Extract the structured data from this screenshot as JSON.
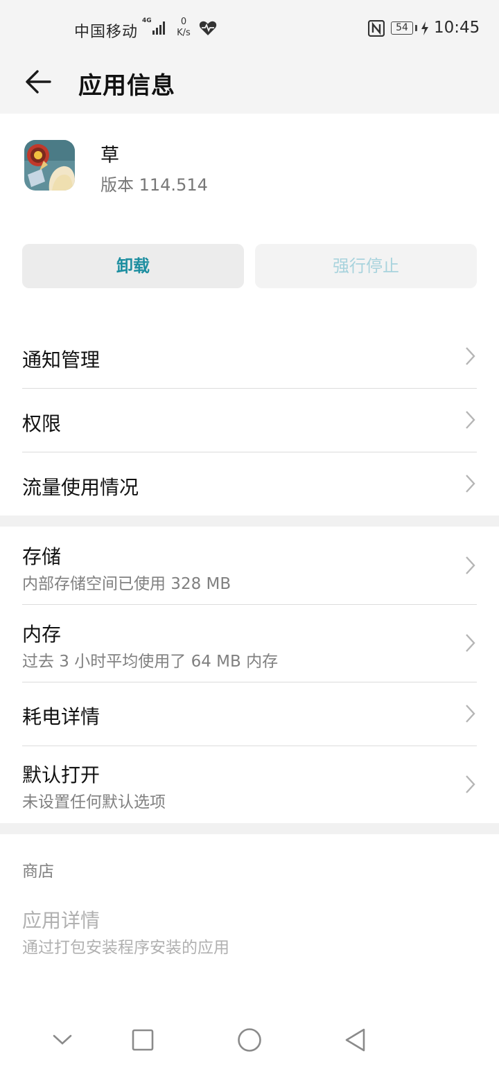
{
  "status_bar": {
    "carrier": "中国移动",
    "network_type": "4G",
    "speed_value": "0",
    "speed_unit": "K/s",
    "battery": "54",
    "time": "10:45"
  },
  "header": {
    "title": "应用信息"
  },
  "app": {
    "name": "草",
    "version": "版本 114.514"
  },
  "actions": {
    "uninstall": "卸载",
    "force_stop": "强行停止"
  },
  "rows": {
    "notifications": "通知管理",
    "permissions": "权限",
    "data_usage": "流量使用情况",
    "storage": {
      "title": "存储",
      "subtitle": "内部存储空间已使用 328 MB"
    },
    "memory": {
      "title": "内存",
      "subtitle": "过去 3 小时平均使用了 64 MB 内存"
    },
    "battery_usage": "耗电详情",
    "open_by_default": {
      "title": "默认打开",
      "subtitle": "未设置任何默认选项"
    }
  },
  "store": {
    "section_label": "商店",
    "app_details_title": "应用详情",
    "app_details_subtitle": "通过打包安装程序安装的应用"
  }
}
